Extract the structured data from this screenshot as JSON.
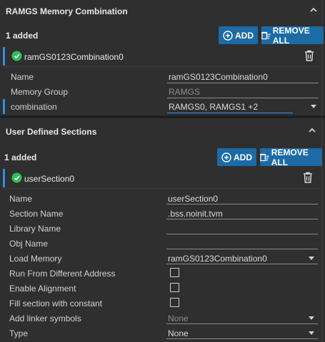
{
  "ramgs": {
    "title": "RAMGS Memory Combination",
    "added": "1 added",
    "add_label": "ADD",
    "remove_all_label": "REMOVE ALL",
    "instance": "ramGS0123Combination0",
    "fields": {
      "name_label": "Name",
      "name_value": "ramGS0123Combination0",
      "group_label": "Memory Group",
      "group_value": "RAMGS",
      "combination_label": "combination",
      "combination_value": "RAMGS0, RAMGS1 +2"
    }
  },
  "uds": {
    "title": "User Defined Sections",
    "added": "1 added",
    "add_label": "ADD",
    "remove_all_label": "REMOVE ALL",
    "instance": "userSection0",
    "fields": {
      "name_label": "Name",
      "name_value": "userSection0",
      "section_label": "Section Name",
      "section_value": ".bss.noinit.tvm",
      "library_label": "Library Name",
      "library_value": "",
      "obj_label": "Obj Name",
      "obj_value": "",
      "load_label": "Load Memory",
      "load_value": "ramGS0123Combination0",
      "run_label": "Run From Different Address",
      "align_label": "Enable Alignment",
      "fill_label": "Fill section with constant",
      "linker_label": "Add linker symbols",
      "linker_value": "None",
      "type_label": "Type",
      "type_value": "None"
    }
  },
  "colors": {
    "accent": "#1c6ba6",
    "focus": "#2f8ee8",
    "check": "#2ebd59"
  },
  "icons": [
    "chevron-up-icon",
    "add-circle-icon",
    "remove-all-icon",
    "check-circle-icon",
    "trash-icon",
    "caret-down-icon"
  ]
}
